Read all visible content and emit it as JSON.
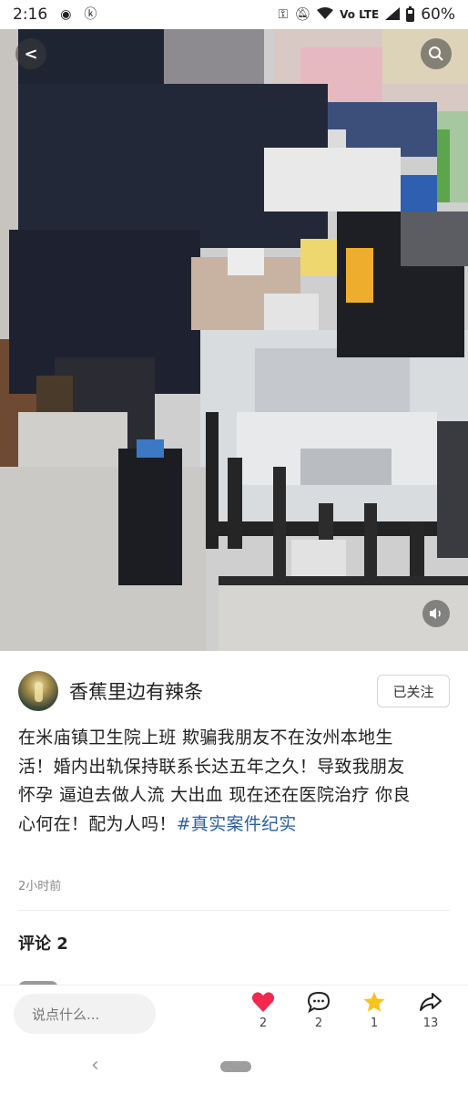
{
  "status_bar": {
    "time": "2:16",
    "signal_label": "Vo LTE",
    "battery": "60%"
  },
  "icons": {
    "back": "chevron-left-icon",
    "search": "search-icon",
    "volume": "volume-icon",
    "like": "heart-icon",
    "comment": "comment-icon",
    "favorite": "star-icon",
    "share": "share-icon"
  },
  "colors": {
    "like": "#f2294d",
    "favorite": "#f7c31d",
    "hashtag": "#2a5fa0"
  },
  "author": {
    "name": "香蕉里边有辣条",
    "follow_label": "已关注"
  },
  "post": {
    "lines": [
      "在米庙镇卫生院上班 欺骗我朋友不在汝州本地生",
      "活！婚内出轨保持联系长达五年之久！导致我朋友",
      "怀孕 逼迫去做人流 大出血 现在还在医院治疗 你良"
    ],
    "last_line_text": "心何在！配为人吗！",
    "hashtag": "#真实案件纪实",
    "time": "2小时前"
  },
  "comments": {
    "title": "评论 2"
  },
  "actions": {
    "input_placeholder": "说点什么...",
    "like_count": "2",
    "comment_count": "2",
    "favorite_count": "1",
    "share_count": "13"
  }
}
